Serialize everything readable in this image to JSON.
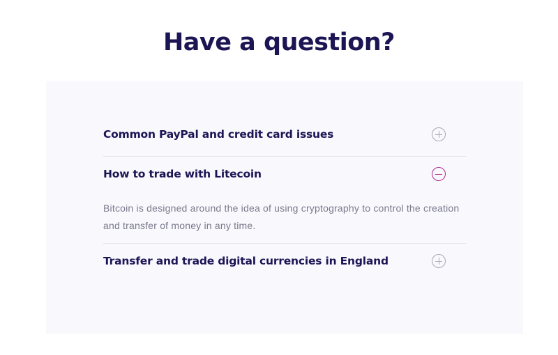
{
  "page": {
    "title": "Have a question?"
  },
  "faq": {
    "items": [
      {
        "question": "Common PayPal and credit card issues",
        "expanded": false,
        "toggle_icon": "plus-circle-icon"
      },
      {
        "question": "How to trade with Litecoin",
        "expanded": true,
        "toggle_icon": "minus-circle-icon",
        "answer": "Bitcoin is designed around the idea of using cryptography to control the creation and transfer of money in any time."
      },
      {
        "question": "Transfer and trade digital currencies in England",
        "expanded": false,
        "toggle_icon": "plus-circle-icon"
      }
    ]
  },
  "colors": {
    "heading": "#1c1554",
    "panel_background": "#f8f8fd",
    "answer_text": "#7b7a8c",
    "icon_default": "#a9a8b4",
    "icon_active": "#b02a8d",
    "divider": "#e3e2ea"
  }
}
